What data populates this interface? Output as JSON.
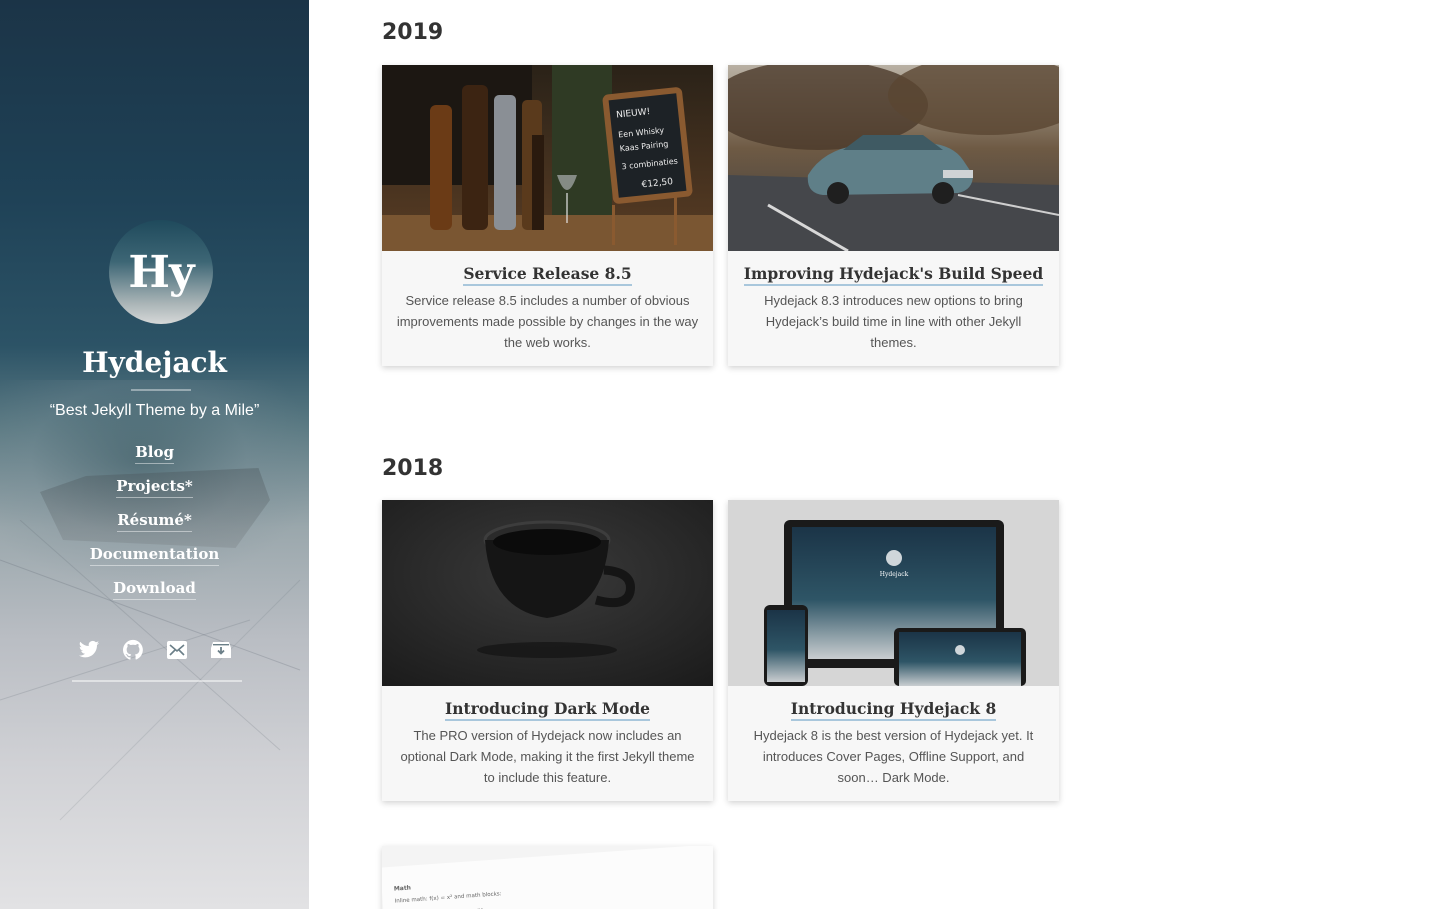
{
  "sidebar": {
    "avatar_text": "Hy",
    "site_title": "Hydejack",
    "tagline": "“Best Jekyll Theme by a Mile”",
    "nav": [
      {
        "label": "Blog"
      },
      {
        "label": "Projects*"
      },
      {
        "label": "Résumé*"
      },
      {
        "label": "Documentation"
      },
      {
        "label": "Download"
      }
    ],
    "social_icons": [
      "twitter-icon",
      "github-icon",
      "email-icon",
      "archive-icon"
    ]
  },
  "sections": [
    {
      "year": "2019",
      "posts": [
        {
          "title": "Service Release 8.5",
          "description": "Service release 8.5 includes a number of obvious improvements made possible by changes in the way the web works.",
          "image": "bar-bottles-chalkboard"
        },
        {
          "title": "Improving Hydejack's Build Speed",
          "description": "Hydejack 8.3 introduces new options to bring Hydejack’s build time in line with other Jekyll themes.",
          "image": "vintage-car-road"
        }
      ]
    },
    {
      "year": "2018",
      "posts": [
        {
          "title": "Introducing Dark Mode",
          "description": "The PRO version of Hydejack now includes an optional Dark Mode, making it the first Jekyll theme to include this feature.",
          "image": "black-coffee-cup"
        },
        {
          "title": "Introducing Hydejack 8",
          "description": "Hydejack 8 is the best version of Hydejack yet. It introduces Cover Pages, Offline Support, and soon… Dark Mode.",
          "image": "devices-mockup"
        },
        {
          "title": "",
          "description": "",
          "image": "math-document",
          "image_text": {
            "heading": "Math",
            "line": "Inline math: f(x) = x² and math blocks:"
          }
        }
      ]
    }
  ],
  "device_mockup_text": {
    "title": "Hydejack"
  },
  "colors": {
    "sidebar_top": "#1b3447",
    "sidebar_bottom": "#e2e2e4",
    "card_background": "#f7f7f7",
    "title_underline": "#a9c7dc",
    "text": "#333333"
  }
}
